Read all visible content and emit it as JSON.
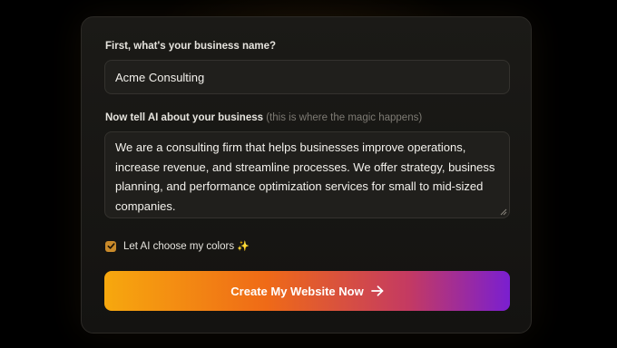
{
  "form": {
    "business_name_label": "First, what's your business name?",
    "business_name_value": "Acme Consulting",
    "about_label": "Now tell AI about your business",
    "about_hint": "(this is where the magic happens)",
    "about_value": "We are a consulting firm that helps businesses improve operations, increase revenue, and streamline processes. We offer strategy, business planning, and performance optimization services for small to mid-sized companies.",
    "colors_checkbox": {
      "label": "Let AI choose my colors",
      "sparkle": "✨",
      "checked": true
    },
    "submit_label": "Create My Website Now"
  },
  "colors": {
    "accent_check": "#c98a2a",
    "gradient_start": "#f7a80e",
    "gradient_mid": "#ef6a17",
    "gradient_end": "#7a1fd0"
  },
  "icons": {
    "submit_icon": "arrow-right-icon",
    "checkbox_icon": "checkmark-icon",
    "sparkle_icon": "sparkle-icon"
  }
}
